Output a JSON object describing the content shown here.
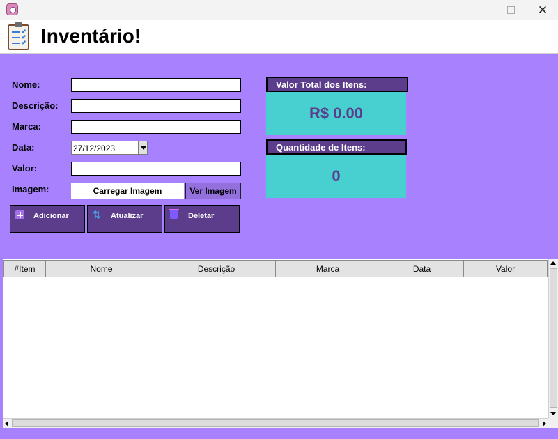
{
  "window": {
    "min_icon": "minimize-icon",
    "max_icon": "maximize-icon",
    "close_glyph": "✕"
  },
  "header": {
    "title": "Inventário!",
    "logo_icon": "clipboard-checklist-icon"
  },
  "form": {
    "nome_label": "Nome:",
    "descricao_label": "Descrição:",
    "marca_label": "Marca:",
    "data_label": "Data:",
    "data_value": "27/12/2023",
    "valor_label": "Valor:",
    "imagem_label": "Imagem:",
    "carregar_label": "Carregar Imagem",
    "ver_label": "Ver Imagem"
  },
  "actions": {
    "adicionar": "Adicionar",
    "atualizar": "Atualizar",
    "deletar": "Deletar"
  },
  "summary": {
    "valor_total_label": "Valor Total dos Itens:",
    "valor_total_value": "R$ 0.00",
    "quantidade_label": "Quantidade de Itens:",
    "quantidade_value": "0"
  },
  "table": {
    "columns": [
      "#Item",
      "Nome",
      "Descrição",
      "Marca",
      "Data",
      "Valor"
    ],
    "rows": []
  },
  "colors": {
    "background": "#a881fe",
    "button": "#5b3d8b",
    "summary_box": "#48cfcf"
  }
}
